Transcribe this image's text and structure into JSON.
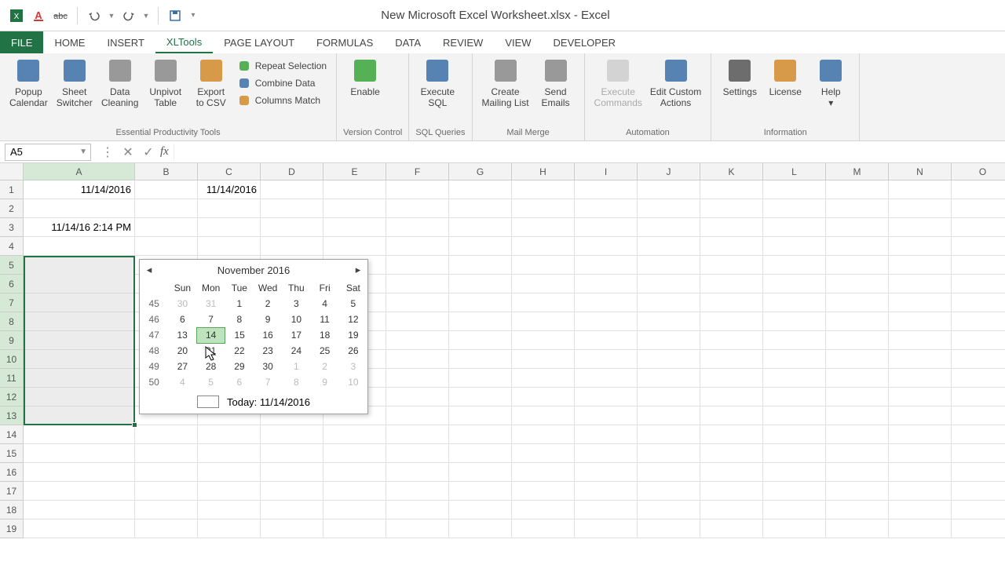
{
  "app_title": "New Microsoft Excel Worksheet.xlsx - Excel",
  "tabs": {
    "file": "FILE",
    "items": [
      "HOME",
      "INSERT",
      "XLTools",
      "PAGE LAYOUT",
      "FORMULAS",
      "DATA",
      "REVIEW",
      "VIEW",
      "DEVELOPER"
    ],
    "active": "XLTools"
  },
  "ribbon": {
    "groups": [
      {
        "label": "Essential Productivity Tools",
        "big": [
          {
            "name": "popup-calendar",
            "l1": "Popup",
            "l2": "Calendar"
          },
          {
            "name": "sheet-switcher",
            "l1": "Sheet",
            "l2": "Switcher"
          },
          {
            "name": "data-cleaning",
            "l1": "Data",
            "l2": "Cleaning"
          },
          {
            "name": "unpivot-table",
            "l1": "Unpivot",
            "l2": "Table"
          },
          {
            "name": "export-csv",
            "l1": "Export",
            "l2": "to CSV"
          }
        ],
        "small": [
          {
            "name": "repeat-selection",
            "label": "Repeat Selection"
          },
          {
            "name": "combine-data",
            "label": "Combine Data"
          },
          {
            "name": "columns-match",
            "label": "Columns Match"
          }
        ]
      },
      {
        "label": "Version Control",
        "big": [
          {
            "name": "enable",
            "l1": "Enable",
            "l2": ""
          }
        ]
      },
      {
        "label": "SQL Queries",
        "big": [
          {
            "name": "execute-sql",
            "l1": "Execute",
            "l2": "SQL"
          }
        ]
      },
      {
        "label": "Mail Merge",
        "big": [
          {
            "name": "create-mailing-list",
            "l1": "Create",
            "l2": "Mailing List"
          },
          {
            "name": "send-emails",
            "l1": "Send",
            "l2": "Emails"
          }
        ]
      },
      {
        "label": "Automation",
        "big": [
          {
            "name": "execute-commands",
            "l1": "Execute",
            "l2": "Commands",
            "disabled": true
          },
          {
            "name": "edit-custom-actions",
            "l1": "Edit Custom",
            "l2": "Actions"
          }
        ]
      },
      {
        "label": "Information",
        "big": [
          {
            "name": "settings",
            "l1": "Settings",
            "l2": ""
          },
          {
            "name": "license",
            "l1": "License",
            "l2": ""
          },
          {
            "name": "help",
            "l1": "Help",
            "l2": "▾"
          }
        ]
      }
    ]
  },
  "name_box": "A5",
  "formula": "",
  "columns": [
    "A",
    "B",
    "C",
    "D",
    "E",
    "F",
    "G",
    "H",
    "I",
    "J",
    "K",
    "L",
    "M",
    "N",
    "O"
  ],
  "rows": [
    1,
    2,
    3,
    4,
    5,
    6,
    7,
    8,
    9,
    10,
    11,
    12,
    13,
    14,
    15,
    16,
    17,
    18,
    19
  ],
  "cell_values": {
    "A1": "11/14/2016",
    "C1": "11/14/2016",
    "A3": "11/14/16 2:14 PM"
  },
  "selection": {
    "active": "A5",
    "range": "A5:A13",
    "sel_rows": [
      5,
      6,
      7,
      8,
      9,
      10,
      11,
      12,
      13
    ]
  },
  "calendar": {
    "title": "November 2016",
    "today_label": "Today: 11/14/2016",
    "dow": [
      "Sun",
      "Mon",
      "Tue",
      "Wed",
      "Thu",
      "Fri",
      "Sat"
    ],
    "weeks": [
      {
        "wk": 45,
        "days": [
          {
            "d": 30,
            "dim": true
          },
          {
            "d": 31,
            "dim": true
          },
          {
            "d": 1
          },
          {
            "d": 2
          },
          {
            "d": 3
          },
          {
            "d": 4
          },
          {
            "d": 5
          }
        ]
      },
      {
        "wk": 46,
        "days": [
          {
            "d": 6
          },
          {
            "d": 7
          },
          {
            "d": 8
          },
          {
            "d": 9
          },
          {
            "d": 10
          },
          {
            "d": 11
          },
          {
            "d": 12
          }
        ]
      },
      {
        "wk": 47,
        "days": [
          {
            "d": 13
          },
          {
            "d": 14,
            "today": true
          },
          {
            "d": 15
          },
          {
            "d": 16
          },
          {
            "d": 17
          },
          {
            "d": 18
          },
          {
            "d": 19
          }
        ]
      },
      {
        "wk": 48,
        "days": [
          {
            "d": 20
          },
          {
            "d": 21
          },
          {
            "d": 22
          },
          {
            "d": 23
          },
          {
            "d": 24
          },
          {
            "d": 25
          },
          {
            "d": 26
          }
        ]
      },
      {
        "wk": 49,
        "days": [
          {
            "d": 27
          },
          {
            "d": 28
          },
          {
            "d": 29
          },
          {
            "d": 30
          },
          {
            "d": 1,
            "dim": true
          },
          {
            "d": 2,
            "dim": true
          },
          {
            "d": 3,
            "dim": true
          }
        ]
      },
      {
        "wk": 50,
        "days": [
          {
            "d": 4,
            "dim": true
          },
          {
            "d": 5,
            "dim": true
          },
          {
            "d": 6,
            "dim": true
          },
          {
            "d": 7,
            "dim": true
          },
          {
            "d": 8,
            "dim": true
          },
          {
            "d": 9,
            "dim": true
          },
          {
            "d": 10,
            "dim": true
          }
        ]
      }
    ]
  }
}
